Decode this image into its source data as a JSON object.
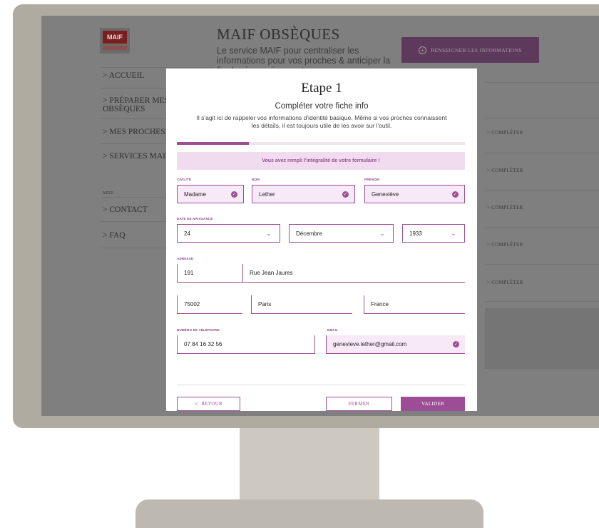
{
  "app": {
    "logo": "MAIF",
    "title": "MAIF OBSÈQUES",
    "subtitle": "Le service MAIF pour centraliser les informations pour vos proches & anticiper la fin de vie sereinement",
    "cta": "RENSEIGNER LES INFORMATIONS",
    "nav": [
      "> ACCUEIL",
      "> PRÉPARER MES OBSÈQUES",
      "> MES PROCHES",
      "> SERVICES MAIF"
    ],
    "aides_label": "AIDES",
    "nav_help": [
      "> CONTACT",
      "> FAQ"
    ],
    "completer": "> COMPLÉTER"
  },
  "modal": {
    "title": "Etape 1",
    "subtitle": "Compléter votre fiche info",
    "description": "Il s'agit ici de rappeler vos informations d'identité basique. Même si vos proches connaissent les détails, il est toujours utile de les avoir sur l'outil.",
    "progress": 0.25,
    "banner": "Vous avez rempli l'intégralité de votre formulaire !",
    "labels": {
      "civilite": "CIVILITÉ",
      "nom": "NOM",
      "prenom": "PRÉNOM",
      "date": "DATE DE NAISSANCE",
      "adresse": "ADRESSE",
      "telephone": "NUMÉRO DE TÉLÉPHONE",
      "email": "EMAIL"
    },
    "values": {
      "civilite": "Madame",
      "nom": "Lether",
      "prenom": "Geneviève",
      "jour": "24",
      "mois": "Décembre",
      "annee": "1933",
      "numero": "191",
      "rue": "Rue Jean Jaures",
      "code_postal": "75002",
      "ville": "Paris",
      "pays": "France",
      "telephone": "07 84 16 32 56",
      "email": "genevieve.lether@gmail.com"
    },
    "buttons": {
      "retour": "RETOUR",
      "fermer": "FERMER",
      "valider": "VALIDER"
    },
    "accent": "#9c4d96"
  }
}
